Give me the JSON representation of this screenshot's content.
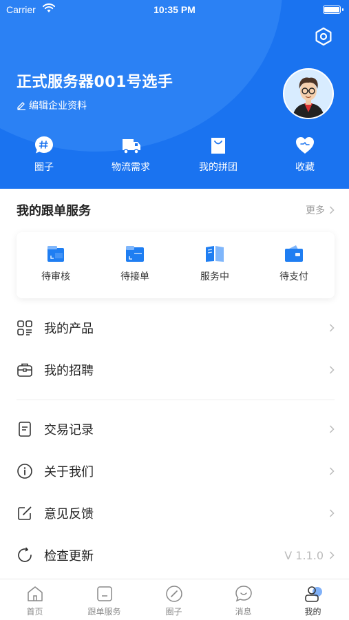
{
  "status_bar": {
    "carrier": "Carrier",
    "time": "10:35 PM"
  },
  "profile": {
    "name": "正式服务器001号选手",
    "edit_label": "编辑企业资料"
  },
  "quick_actions": [
    {
      "label": "圈子",
      "icon": "hashtag-chat-icon"
    },
    {
      "label": "物流需求",
      "icon": "truck-icon"
    },
    {
      "label": "我的拼团",
      "icon": "shopping-bag-icon"
    },
    {
      "label": "收藏",
      "icon": "heart-icon"
    }
  ],
  "orders_section": {
    "title": "我的跟单服务",
    "more": "更多",
    "items": [
      {
        "label": "待审核",
        "icon": "pending-review-icon"
      },
      {
        "label": "待接单",
        "icon": "folder-icon"
      },
      {
        "label": "服务中",
        "icon": "book-icon"
      },
      {
        "label": "待支付",
        "icon": "wallet-icon"
      }
    ]
  },
  "menu": [
    {
      "label": "我的产品",
      "icon": "grid-list-icon"
    },
    {
      "label": "我的招聘",
      "icon": "briefcase-icon"
    },
    {
      "label": "交易记录",
      "icon": "document-icon"
    },
    {
      "label": "关于我们",
      "icon": "info-icon"
    },
    {
      "label": "意见反馈",
      "icon": "edit-square-icon"
    },
    {
      "label": "检查更新",
      "icon": "refresh-icon",
      "value": "V 1.1.0"
    }
  ],
  "tabbar": [
    {
      "label": "首页",
      "icon": "home-icon"
    },
    {
      "label": "跟单服务",
      "icon": "service-icon"
    },
    {
      "label": "圈子",
      "icon": "compass-icon"
    },
    {
      "label": "消息",
      "icon": "message-icon"
    },
    {
      "label": "我的",
      "icon": "user-icon",
      "active": true
    }
  ],
  "colors": {
    "primary": "#1a73f0",
    "tab_active": "#1a73f0",
    "text": "#222222",
    "muted": "#999999"
  }
}
